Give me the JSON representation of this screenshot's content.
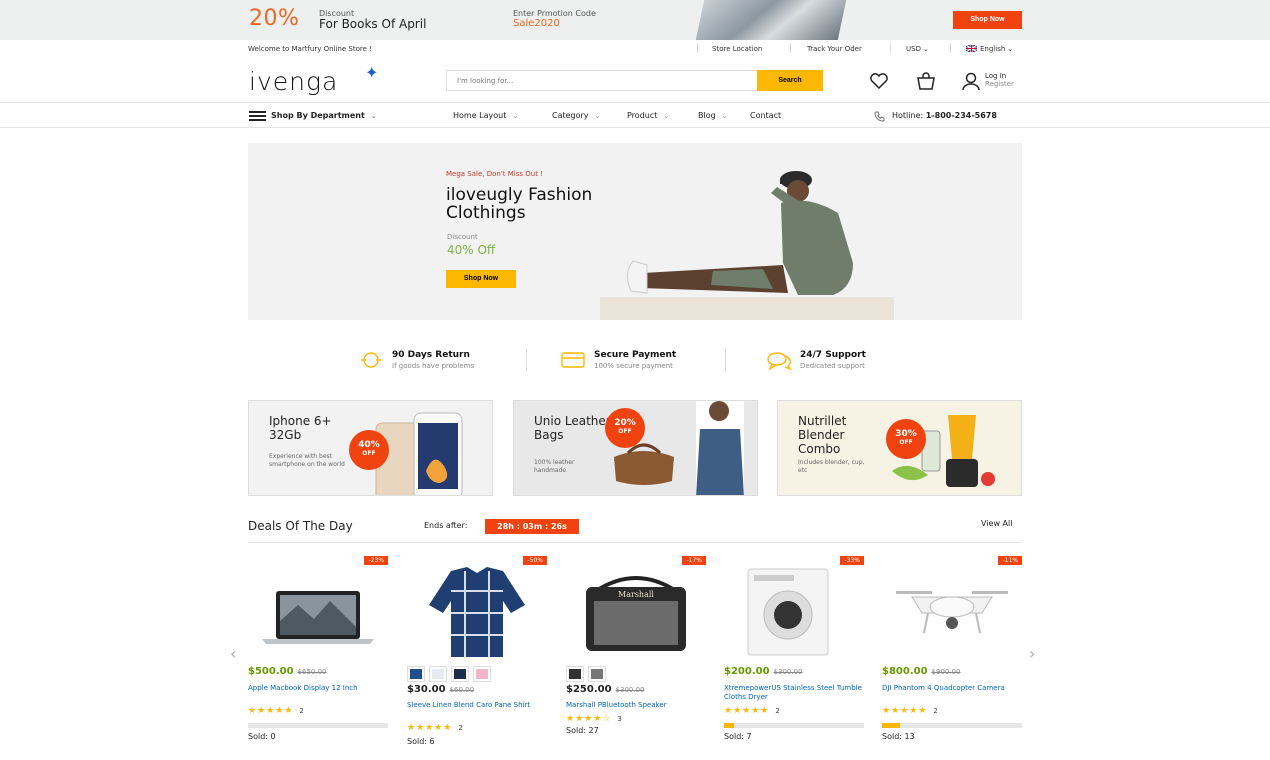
{
  "promo_bar": {
    "percent": "20%",
    "discount_label": "Discount",
    "discount_text": "For Books Of April",
    "code_label": "Enter Prmotion Code",
    "code_value": "Sale2020",
    "button": "Shop Now"
  },
  "topbar": {
    "welcome": "Welcome to Martfury Online Store !",
    "store_location": "Store Location",
    "track_order": "Track Your Oder",
    "currency": "USD",
    "language": "English"
  },
  "header": {
    "logo": "ivenga",
    "search_placeholder": "I'm looking for...",
    "search_button": "Search",
    "login": "Log In",
    "register": "Register"
  },
  "nav": {
    "department": "Shop By Department",
    "items": [
      "Home Layout",
      "Category",
      "Product",
      "Blog",
      "Contact"
    ],
    "hotline_label": "Hotline:",
    "hotline_number": "1-800-234-5678"
  },
  "hero": {
    "tag": "Mega Sale, Don't Miss Out !",
    "title": "iloveugly Fashion Clothings",
    "discount_label": "Discount",
    "discount_value": "40% Off",
    "button": "Shop Now"
  },
  "features": [
    {
      "title": "90 Days Return",
      "subtitle": "If goods have problems",
      "icon": "refresh-icon"
    },
    {
      "title": "Secure Payment",
      "subtitle": "100% secure payment",
      "icon": "credit-card-icon"
    },
    {
      "title": "24/7 Support",
      "subtitle": "Dedicated support",
      "icon": "chat-icon"
    }
  ],
  "promo_cards": [
    {
      "title": "Iphone 6+ 32Gb",
      "subtitle": "Experience with best smartphone on the world",
      "badge": "40%",
      "badge_off": "OFF"
    },
    {
      "title": "Unio Leather Bags",
      "subtitle": "100% leather handmade",
      "badge": "20%",
      "badge_off": "OFF"
    },
    {
      "title": "Nutrillet Blender Combo",
      "subtitle": "Includes blender, cup, etc",
      "badge": "30%",
      "badge_off": "OFF"
    }
  ],
  "deals": {
    "title": "Deals Of The Day",
    "ends_label": "Ends after:",
    "timer": "28h : 03m : 26s",
    "view_all": "View All",
    "products": [
      {
        "discount": "-23%",
        "price": "$500.00",
        "old_price": "$650.00",
        "name": "Apple Macbook Display 12 Inch",
        "stars": "★★★★★",
        "reviews": "2",
        "sold": "Sold: 0",
        "sold_fraction": 0.0
      },
      {
        "discount": "-50%",
        "price": "$30.00",
        "old_price": "$60.00",
        "name": "Sleeve Linen Blend Caro Pane Shirt",
        "stars": "★★★★★",
        "reviews": "2",
        "sold": "Sold: 6",
        "sold_fraction": 0.0
      },
      {
        "discount": "-17%",
        "price": "$250.00",
        "old_price": "$300.00",
        "name": "Marshall PBluetooth Speaker",
        "stars": "★★★★☆",
        "reviews": "3",
        "sold": "Sold: 27",
        "sold_fraction": 0.0
      },
      {
        "discount": "-33%",
        "price": "$200.00",
        "old_price": "$300.00",
        "name": "XtremepowerUS Stainless Steel Tumble Cloths Dryer",
        "stars": "★★★★★",
        "reviews": "2",
        "sold": "Sold: 7",
        "sold_fraction": 0.07
      },
      {
        "discount": "-11%",
        "price": "$800.00",
        "old_price": "$900.00",
        "name": "DJI Phantom 4 Quadcopter Camera",
        "stars": "★★★★★",
        "reviews": "2",
        "sold": "Sold: 13",
        "sold_fraction": 0.13
      }
    ]
  },
  "colors": {
    "accent": "#f0430f",
    "yellow": "#fcb800",
    "link": "#0066c0",
    "green": "#7cb342"
  }
}
